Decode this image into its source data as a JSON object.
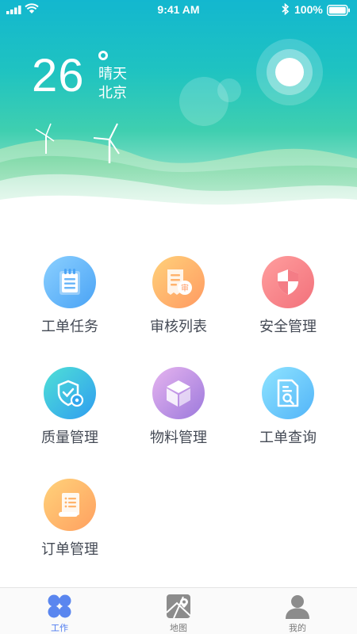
{
  "status_bar": {
    "time": "9:41 AM",
    "battery": "100%"
  },
  "weather": {
    "temperature": "26",
    "condition": "晴天",
    "city": "北京"
  },
  "menu": {
    "items": [
      {
        "label": "工单任务",
        "icon": "notepad-icon",
        "color_from": "#8bd0ff",
        "color_to": "#4aa3f5"
      },
      {
        "label": "审核列表",
        "icon": "receipt-audit-icon",
        "color_from": "#ffd17a",
        "color_to": "#ff9a62"
      },
      {
        "label": "安全管理",
        "icon": "shield-icon",
        "color_from": "#ff9e9e",
        "color_to": "#f2717b"
      },
      {
        "label": "质量管理",
        "icon": "shield-gear-icon",
        "color_from": "#4fe0d6",
        "color_to": "#2f9df0"
      },
      {
        "label": "物料管理",
        "icon": "box-icon",
        "color_from": "#e6b4ef",
        "color_to": "#9c79dc"
      },
      {
        "label": "工单查询",
        "icon": "document-search-icon",
        "color_from": "#8fe4ff",
        "color_to": "#52b4f8"
      },
      {
        "label": "订单管理",
        "icon": "scroll-icon",
        "color_from": "#ffd27a",
        "color_to": "#ffa060"
      }
    ]
  },
  "tabbar": {
    "tabs": [
      {
        "label": "工作",
        "icon": "grid-icon",
        "active": true
      },
      {
        "label": "地图",
        "icon": "map-icon",
        "active": false
      },
      {
        "label": "我的",
        "icon": "person-icon",
        "active": false
      }
    ],
    "active_color": "#4f7cf0",
    "inactive_color": "#8c8c8c"
  }
}
